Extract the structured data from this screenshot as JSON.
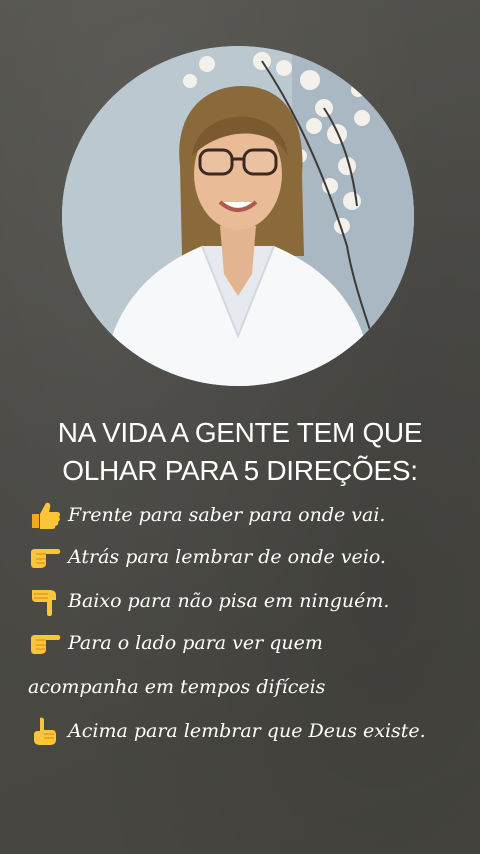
{
  "portrait": {
    "icon": "woman-portrait-photo"
  },
  "headline": {
    "line1": "NA VIDA A GENTE TEM QUE",
    "line2": "OLHAR PARA 5 DIREÇÕES:"
  },
  "directions": [
    {
      "icon": "thumbs-up-emoji",
      "text": "Frente para saber para onde vai."
    },
    {
      "icon": "hand-pointing-right-emoji",
      "text": "Atrás para lembrar de onde veio."
    },
    {
      "icon": "hand-pointing-down-emoji",
      "text": "Baixo para não pisa em ninguém."
    },
    {
      "icon": "hand-pointing-right-emoji",
      "text": "Para o lado para ver quem"
    },
    {
      "icon": "",
      "text": "acompanha em tempos difíceis"
    },
    {
      "icon": "hand-pointing-up-emoji",
      "text": "Acima para lembrar que Deus existe."
    }
  ]
}
